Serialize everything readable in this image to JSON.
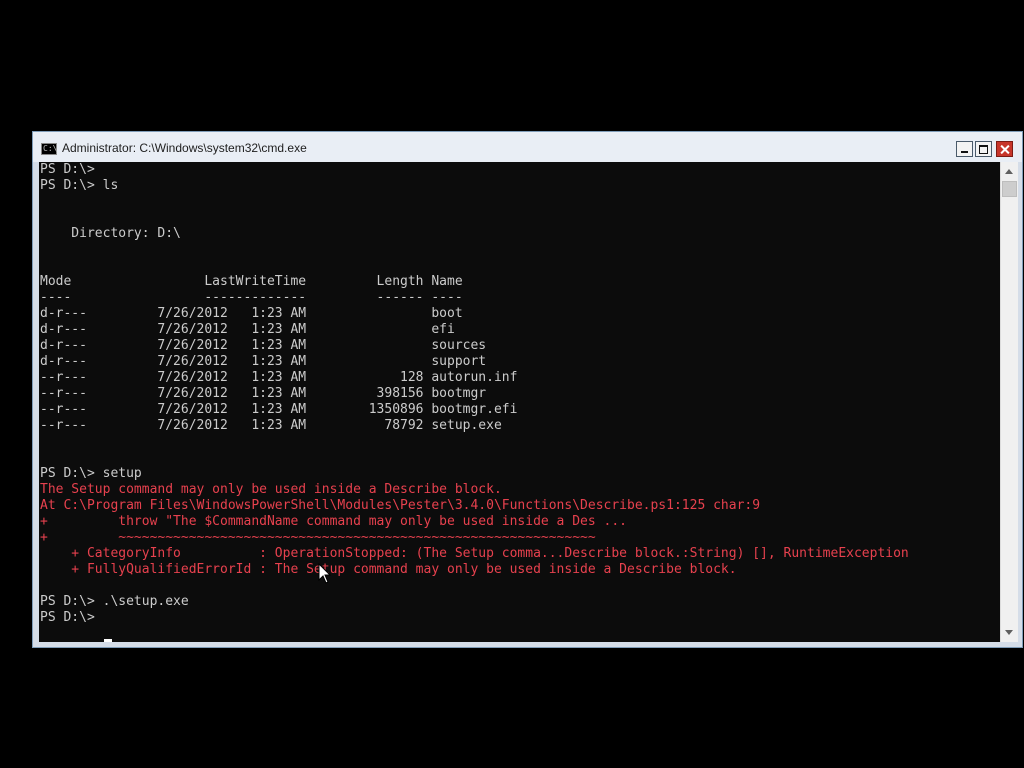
{
  "window": {
    "title": "Administrator: C:\\Windows\\system32\\cmd.exe",
    "icon": "console-icon",
    "icon_glyph": "C:\\",
    "controls": [
      "minimize-icon",
      "maximize-icon",
      "close-icon"
    ]
  },
  "console": {
    "colors": {
      "background": "#0c0c0c",
      "text": "#cccccc",
      "error": "#e7414e"
    },
    "lines": [
      "PS D:\\>",
      "PS D:\\> ls",
      "",
      "",
      "    Directory: D:\\",
      "",
      "",
      "Mode                 LastWriteTime         Length Name",
      "----                 -------------         ------ ----",
      "d-r---         7/26/2012   1:23 AM                boot",
      "d-r---         7/26/2012   1:23 AM                efi",
      "d-r---         7/26/2012   1:23 AM                sources",
      "d-r---         7/26/2012   1:23 AM                support",
      "--r---         7/26/2012   1:23 AM            128 autorun.inf",
      "--r---         7/26/2012   1:23 AM         398156 bootmgr",
      "--r---         7/26/2012   1:23 AM        1350896 bootmgr.efi",
      "--r---         7/26/2012   1:23 AM          78792 setup.exe",
      "",
      "",
      "PS D:\\> setup",
      "The Setup command may only be used inside a Describe block.",
      "At C:\\Program Files\\WindowsPowerShell\\Modules\\Pester\\3.4.0\\Functions\\Describe.ps1:125 char:9",
      "+         throw \"The $CommandName command may only be used inside a Des ...",
      "+         ~~~~~~~~~~~~~~~~~~~~~~~~~~~~~~~~~~~~~~~~~~~~~~~~~~~~~~~~~~~~~",
      "    + CategoryInfo          : OperationStopped: (The Setup comma...Describe block.:String) [], RuntimeException",
      "    + FullyQualifiedErrorId : The Setup command may only be used inside a Describe block.",
      "",
      "PS D:\\> .\\setup.exe",
      "PS D:\\> "
    ],
    "error_lines": [
      20,
      21,
      22,
      23,
      24,
      25
    ]
  },
  "scrollbar": {
    "up_icon": "scroll-up-arrow-icon",
    "down_icon": "scroll-down-arrow-icon"
  },
  "pointer": "mouse-pointer-icon"
}
